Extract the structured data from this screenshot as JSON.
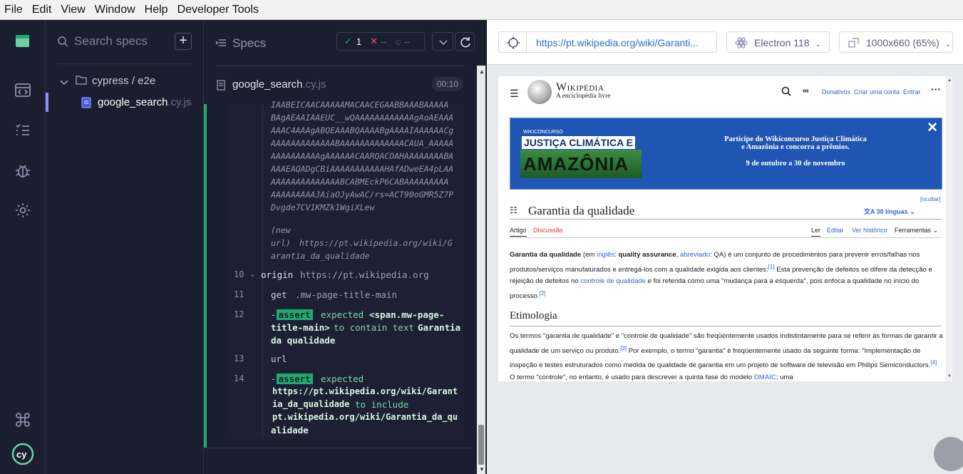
{
  "menu": {
    "file": "File",
    "edit": "Edit",
    "view": "View",
    "window": "Window",
    "help": "Help",
    "devtools": "Developer Tools"
  },
  "specs": {
    "search_placeholder": "Search specs",
    "add": "+",
    "folder": "cypress / e2e",
    "file_name": "google_search",
    "file_ext": ".cy.js"
  },
  "reporter": {
    "title": "Specs",
    "passed": "1",
    "failed": "--",
    "pending": "--",
    "spec_name": "google_search",
    "spec_ext": ".cy.js",
    "duration": "00:10",
    "blob_lines": [
      "IAABEICAACAAAAAMACAACEGAABBAAABAAAAA",
      "BAgAEAAIAAEUC__wQAAAAAAAAAAAAgAoAEAAA",
      "AAAC4AAAgABQEAAABQAAAABgAAAAIAAAAAACg",
      "AAAAAAAAAAAAABAAAAAAAAAAAAACAUA_AAAAA",
      "AAAAAAAAAAgAAAAAACAARQACOAHAAAAAAAABA",
      "AAAEAQADgCBiAAAAAAAAAAAHAfADweEA4pLAA",
      "AAAAAAAAAAAAAABCABMEckP6CABAAAAAAAAA",
      "AAAAAAAAAJAiaOJyAwAC/rs=ACT90oGMR5Z7P",
      "Dvgde7CV1KMZk1WgiXLew"
    ],
    "new_url_label": "(new",
    "new_url_label2": "url)",
    "new_url_1": "https://pt.wikipedia.org/wiki/G",
    "new_url_2": "arantia_da_qualidade",
    "commands": [
      {
        "num": "10",
        "name": "origin",
        "arg": "https://pt.wikipedia.org"
      },
      {
        "num": "11",
        "name": "get",
        "arg": ".mw-page-title-main"
      },
      {
        "num": "12",
        "assert": "assert",
        "w1": "expected",
        "v1a": "<span.mw-page-",
        "v1b": "title-main>",
        "w2": "to contain text",
        "v2a": "Garantia",
        "v2b": "da qualidade"
      },
      {
        "num": "13",
        "name": "url",
        "arg": ""
      },
      {
        "num": "14",
        "assert": "assert",
        "w1": "expected",
        "v1a": "https://pt.wikipedia.org/wiki/Garant",
        "v1b": "ia_da_qualidade",
        "w2": "to include",
        "v2a": "pt.wikipedia.org/wiki/Garantia_da_qu",
        "v2b": "alidade"
      }
    ]
  },
  "aut": {
    "url": "https://pt.wikipedia.org/wiki/Garanti...",
    "browser": "Electron 118",
    "viewport": "1000x660 (65%)"
  },
  "wiki": {
    "wordmark": "Wikipédia",
    "tagline": "A enciclopédia livre",
    "donate": "Donativos",
    "create": "Criar uma conta",
    "login": "Entrar",
    "banner_small": "WIKICONCURSO",
    "banner_big1": "JUSTIÇA CLIMÁTICA E",
    "banner_big2": "AMAZÔNIA",
    "banner_l1": "Participe do Wikiconcurso Justiça Climática",
    "banner_l2": "e Amazônia e concorra a prêmios.",
    "banner_l3": "9 de outubro a 30 de novembro",
    "hide": "[ocultar]",
    "title": "Garantia da qualidade",
    "langs": "30 línguas",
    "tab_article": "Artigo",
    "tab_talk": "Discussão",
    "tab_read": "Ler",
    "tab_edit": "Editar",
    "tab_history": "Ver histórico",
    "tab_tools": "Ferramentas",
    "p1": {
      "b": "Garantia da qualidade",
      "t1": " (em ",
      "l1": "inglês",
      "t2": ": ",
      "b2": "quality assurance",
      "t3": ", ",
      "l2": "abreviado",
      "t4": ": QA) é um conjunto de procedimentos para prevenir erros/falhas nos produtos/serviços manufaturados e entregá-los com a qualidade exigida aos clientes:",
      "r1": "[1]",
      "t5": " Esta prevenção de defeitos se difere da detecção e rejeição de defeitos no ",
      "l3": "controle de qualidade",
      "t6": " e foi referida como uma \"mudança para a esquerda\", pois enfoca a qualidade no início do processo.",
      "r2": "[2]"
    },
    "h2": "Etimologia",
    "p2": {
      "t1": "Os termos \"garantia de qualidade\" e \"controle de qualidade\" são freqüentemente usados indistintamente para se referir às formas de garantir a qualidade de um serviço ou produto.",
      "r1": "[3]",
      "t2": " Por exemplo, o termo \"garantia\" é freqüentemente usado da seguinte forma: \"Implementação de inspeção e testes estruturados como medida de qualidade de garantia em um projeto de software de televisão em Philips Semiconductors.",
      "r2": "[4]",
      "t3": " O termo \"controle\", no entanto, é usado para descrever a quinta fase do modelo ",
      "l1": "DMAIC",
      "t4": "; uma"
    }
  }
}
